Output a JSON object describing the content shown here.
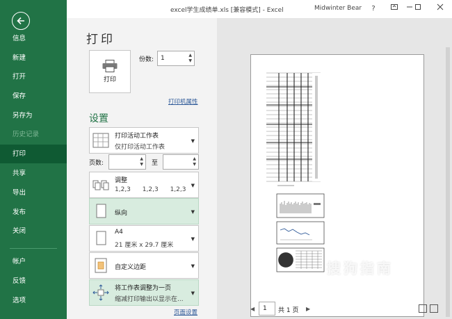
{
  "title_bar": {
    "doc_title": "excel学生成绩单.xls  [兼容模式]  -  Excel",
    "user_name": "Midwinter Bear",
    "help": "?",
    "controls": [
      "restore-ribbon",
      "minimize",
      "maximize",
      "close"
    ]
  },
  "nav": {
    "back_icon": "back-arrow-icon",
    "items": [
      {
        "label": "信息",
        "state": "normal"
      },
      {
        "label": "新建",
        "state": "normal"
      },
      {
        "label": "打开",
        "state": "normal"
      },
      {
        "label": "保存",
        "state": "normal"
      },
      {
        "label": "另存为",
        "state": "normal"
      },
      {
        "label": "历史记录",
        "state": "disabled"
      },
      {
        "label": "打印",
        "state": "active"
      },
      {
        "label": "共享",
        "state": "normal"
      },
      {
        "label": "导出",
        "state": "normal"
      },
      {
        "label": "发布",
        "state": "normal"
      },
      {
        "label": "关闭",
        "state": "normal"
      },
      {
        "label": "帐户",
        "state": "normal"
      },
      {
        "label": "反馈",
        "state": "normal"
      },
      {
        "label": "选项",
        "state": "normal"
      }
    ]
  },
  "print_panel": {
    "heading": "打印",
    "print_button_label": "打印",
    "copies_label": "份数:",
    "copies_value": "1",
    "printer_properties_link": "打印机属性",
    "settings_heading": "设置",
    "print_what": {
      "title": "打印活动工作表",
      "subtitle": "仅打印活动工作表"
    },
    "pages_label": "页数:",
    "pages_to_label": "至",
    "pages_from": "",
    "pages_to": "",
    "collate": {
      "title": "调整",
      "values": [
        "1,2,3",
        "1,2,3",
        "1,2,3"
      ]
    },
    "orientation": "纵向",
    "paper": {
      "title": "A4",
      "subtitle": "21 厘米 x 29.7 厘米"
    },
    "margins": "自定义边距",
    "scaling": {
      "title": "将工作表调整为一页",
      "subtitle": "缩减打印输出以显示在..."
    },
    "page_setup_link": "页面设置"
  },
  "preview": {
    "current_page": "1",
    "total_pages": "共 1 页"
  },
  "watermark": "搜狗指南",
  "colors": {
    "nav_bg": "#217346",
    "nav_active": "#0f5a33",
    "accent": "#217346",
    "selected_option": "#d8ecdf"
  }
}
